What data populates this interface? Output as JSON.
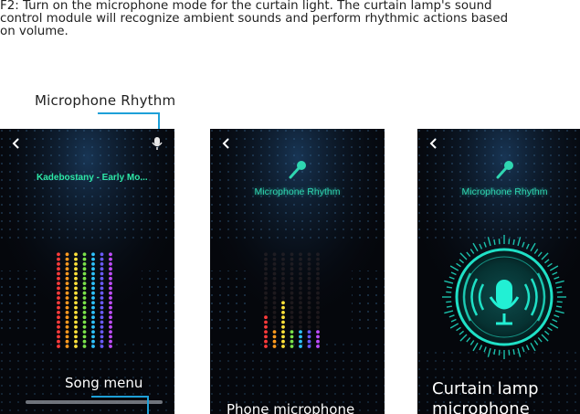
{
  "intro": {
    "line1": "F2: Turn on the microphone mode for the curtain light. The curtain lamp's sound",
    "line2": "control module will recognize ambient sounds and perform rhythmic actions based",
    "line3": "on volume."
  },
  "callouts": {
    "microphone_rhythm": "Microphone Rhythm",
    "song_menu": "Song menu",
    "phone_microphone": "Phone microphone",
    "curtain_lamp_line1": "Curtain lamp",
    "curtain_lamp_line2": "microphone"
  },
  "screens": {
    "left": {
      "song_title": "Kadebostany - Early Mo..."
    },
    "middle": {
      "title": "Microphone Rhythm"
    },
    "right": {
      "title": "Microphone Rhythm"
    }
  },
  "colors": {
    "accent": "#1ea0d8",
    "title_green": "#2fd6b1",
    "mic_glow": "#18e0c8"
  },
  "icons": [
    "back-icon",
    "microphone-icon",
    "microphone-glow-icon"
  ]
}
